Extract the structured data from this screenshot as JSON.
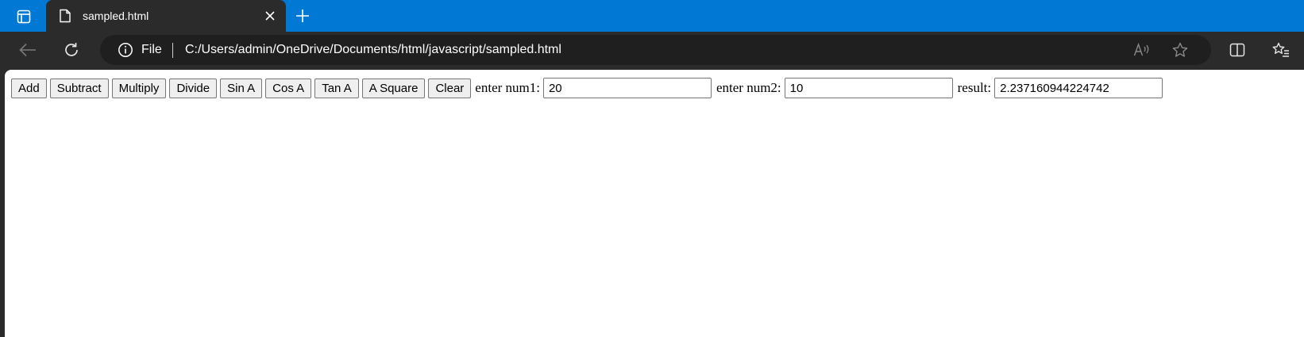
{
  "browser": {
    "tab_title": "sampled.html",
    "address": {
      "scheme_label": "File",
      "url": "C:/Users/admin/OneDrive/Documents/html/javascript/sampled.html"
    },
    "icons": [
      "tab-actions-icon",
      "file-icon",
      "close-icon",
      "plus-icon",
      "back-arrow-icon",
      "reload-icon",
      "info-icon",
      "read-aloud-icon",
      "star-icon",
      "split-screen-icon",
      "favorites-icon"
    ],
    "colors": {
      "tabbar": "#0078d4",
      "chrome": "#2b2b2b",
      "omnibox": "#1f1f1f"
    }
  },
  "page": {
    "buttons": {
      "add": "Add",
      "subtract": "Subtract",
      "multiply": "Multiply",
      "divide": "Divide",
      "sin": "Sin A",
      "cos": "Cos A",
      "tan": "Tan A",
      "square": "A Square",
      "clear": "Clear"
    },
    "num1_label": "enter num1:",
    "num1_value": "20",
    "num2_label": "enter num2:",
    "num2_value": "10",
    "result_label": "result:",
    "result_value": "2.237160944224742"
  }
}
